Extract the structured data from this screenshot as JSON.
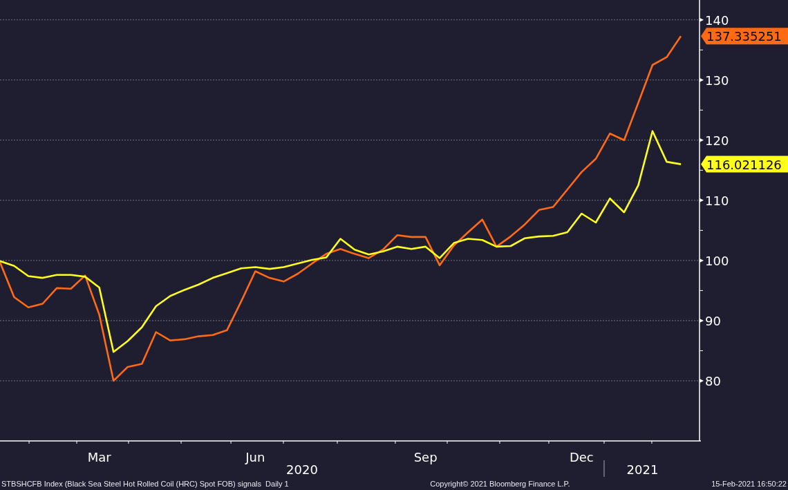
{
  "chart": {
    "chart_data": {
      "type": "line",
      "categories": [
        null,
        null,
        null,
        null,
        null,
        null,
        null,
        "Mar",
        null,
        null,
        null,
        null,
        null,
        null,
        null,
        null,
        null,
        null,
        "Jun",
        null,
        null,
        null,
        null,
        null,
        null,
        null,
        null,
        null,
        null,
        null,
        "Sep",
        null,
        null,
        null,
        null,
        null,
        null,
        null,
        null,
        null,
        null,
        "Dec",
        null,
        null,
        null,
        null,
        null,
        null,
        null
      ],
      "series": [
        {
          "color": "#ff6a13",
          "values": [
            99.7,
            93.9,
            92.2,
            92.8,
            95.4,
            95.3,
            97.5,
            91.0,
            80.0,
            82.3,
            82.8,
            88.1,
            86.7,
            86.9,
            87.4,
            87.6,
            88.4,
            93.2,
            98.2,
            97.1,
            96.5,
            97.8,
            99.5,
            101.1,
            101.9,
            101.1,
            100.4,
            101.8,
            104.2,
            103.9,
            103.9,
            99.2,
            102.5,
            104.7,
            106.8,
            102.3,
            104.0,
            106.0,
            108.4,
            108.9,
            111.8,
            114.7,
            116.9,
            121.1,
            120.0,
            126.2,
            132.5,
            133.8,
            137.3
          ]
        },
        {
          "color": "#ffff1a",
          "values": [
            99.9,
            99.1,
            97.4,
            97.1,
            97.6,
            97.6,
            97.3,
            95.5,
            84.8,
            86.6,
            88.9,
            92.4,
            94.1,
            95.1,
            96.0,
            97.1,
            97.9,
            98.7,
            98.9,
            98.6,
            98.9,
            99.5,
            100.1,
            100.5,
            103.6,
            101.8,
            101.0,
            101.5,
            102.3,
            101.9,
            102.3,
            100.4,
            102.9,
            103.6,
            103.4,
            102.3,
            102.4,
            103.7,
            104.0,
            104.1,
            104.7,
            107.8,
            106.3,
            110.3,
            108.0,
            112.5,
            121.5,
            116.4,
            116.0
          ]
        }
      ],
      "ylim": [
        70,
        143.3
      ],
      "grid": true,
      "yticks": [
        80,
        90,
        100,
        110,
        120,
        130,
        140
      ],
      "annotations": [
        "2020",
        "2021"
      ]
    },
    "value_tags": [
      "137.335251",
      "116.021126"
    ]
  },
  "footer": {
    "description": "STBSHCFB Index (Black Sea Steel Hot Rolled Coil (HRC) Spot FOB) signals  Daily 1",
    "copyright": "Copyright© 2021 Bloomberg Finance L.P.",
    "timestamp": "15-Feb-2021 16:50:22"
  }
}
